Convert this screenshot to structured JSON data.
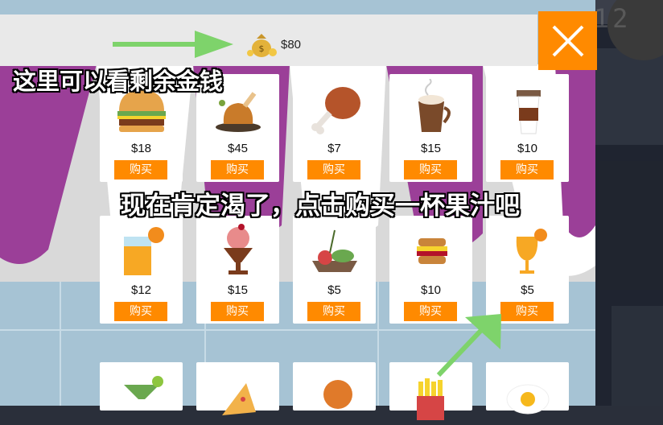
{
  "shop": {
    "money": "$80",
    "items": [
      {
        "name": "burger",
        "price": "$18",
        "buy": "购买"
      },
      {
        "name": "roast-chicken",
        "price": "$45",
        "buy": "购买"
      },
      {
        "name": "drumstick",
        "price": "$7",
        "buy": "购买"
      },
      {
        "name": "hot-chocolate",
        "price": "$15",
        "buy": "购买"
      },
      {
        "name": "coffee",
        "price": "$10",
        "buy": "购买"
      },
      {
        "name": "orange-juice",
        "price": "$12",
        "buy": "购买"
      },
      {
        "name": "ice-cream-sundae",
        "price": "$15",
        "buy": "购买"
      },
      {
        "name": "salad",
        "price": "$5",
        "buy": "购买"
      },
      {
        "name": "sandwich",
        "price": "$10",
        "buy": "购买"
      },
      {
        "name": "fruit-juice",
        "price": "$5",
        "buy": "购买"
      }
    ]
  },
  "clock": "10:12",
  "tips": {
    "money_tip": "这里可以看剩余金钱",
    "buy_tip": "现在肯定渴了，点击购买一杯果汁吧"
  },
  "colors": {
    "accent": "#ff8a00",
    "awning": "#9b3f98",
    "panel": "#a6c3d4"
  }
}
